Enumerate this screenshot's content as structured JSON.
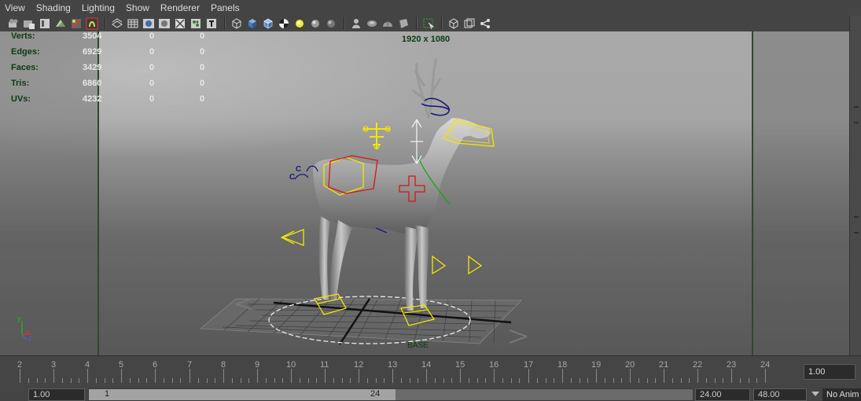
{
  "menu": [
    "View",
    "Shading",
    "Lighting",
    "Show",
    "Renderer",
    "Panels"
  ],
  "toolbar_icons": [
    "camera-icon",
    "camera-attributes-icon",
    "bookmark-icon",
    "image-plane-icon",
    "grid-toggle-icon",
    "film-gate-icon",
    "wireframe-icon",
    "smooth-shade-icon",
    "shade-wireframe-icon",
    "default-material-icon",
    "xray-icon",
    "textured-icon",
    "wireframe-cube-icon",
    "shaded-cube-icon",
    "shaded-wire-cube-icon",
    "checker-texture-icon",
    "default-lighting-icon",
    "all-lights-icon",
    "shadows-icon",
    "isolate-select-icon",
    "xray-joints-icon",
    "smooth-mesh-icon",
    "backface-icon",
    "select-camera-icon",
    "single-view-icon",
    "four-view-icon",
    "share-icon"
  ],
  "hud": {
    "rows": [
      {
        "label": "Verts:",
        "values": [
          "3504",
          "0",
          "0"
        ]
      },
      {
        "label": "Edges:",
        "values": [
          "6929",
          "0",
          "0"
        ]
      },
      {
        "label": "Faces:",
        "values": [
          "3429",
          "0",
          "0"
        ]
      },
      {
        "label": "Tris:",
        "values": [
          "6860",
          "0",
          "0"
        ]
      },
      {
        "label": "UVs:",
        "values": [
          "4232",
          "0",
          "0"
        ]
      }
    ]
  },
  "resolution": "1920 x 1080",
  "timeline": {
    "ticks": [
      "2",
      "3",
      "4",
      "5",
      "6",
      "7",
      "8",
      "9",
      "10",
      "11",
      "12",
      "13",
      "14",
      "15",
      "16",
      "17",
      "18",
      "19",
      "20",
      "21",
      "22",
      "23",
      "24"
    ],
    "current_frame": "1.00"
  },
  "range": {
    "start_time": "1.00",
    "playback_start": "1",
    "playback_end": "24",
    "playback_end_field": "24.00",
    "end_time": "48.00",
    "anim_layer": "No Anim"
  },
  "colors": {
    "ui_bg": "#444444",
    "hud_label": "#0b3b12",
    "hud_value": "#e8e8e8",
    "control_yellow": "#f2e600",
    "control_red": "#d81414",
    "control_navy": "#1a1a78",
    "control_green": "#18a418"
  }
}
